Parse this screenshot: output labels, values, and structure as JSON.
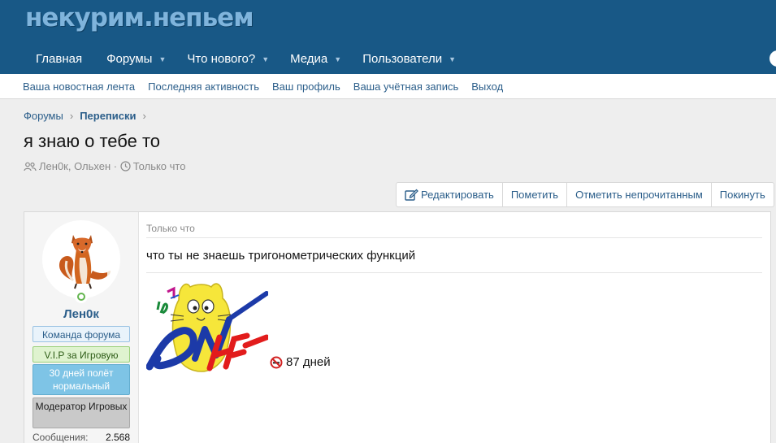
{
  "header": {
    "logo_text": "некурим.непьем",
    "nav": [
      {
        "label": "Главная",
        "has_caret": false
      },
      {
        "label": "Форумы",
        "has_caret": true
      },
      {
        "label": "Что нового?",
        "has_caret": true
      },
      {
        "label": "Медиа",
        "has_caret": true
      },
      {
        "label": "Пользователи",
        "has_caret": true
      }
    ]
  },
  "subnav": [
    "Ваша новостная лента",
    "Последняя активность",
    "Ваш профиль",
    "Ваша учётная запись",
    "Выход"
  ],
  "breadcrumb": [
    "Форумы",
    "Переписки"
  ],
  "page": {
    "title": "я знаю о тебе то",
    "participants": "Лен0к, Ольхен",
    "time": "Только что"
  },
  "actions": [
    "Редактировать",
    "Пометить",
    "Отметить непрочитанным",
    "Покинуть"
  ],
  "message": {
    "author": "Лен0к",
    "badges": [
      "Команда форума",
      "V.I.P за Игровую",
      "30 дней полёт нормальный",
      "Модератор Игровых"
    ],
    "stat_label": "Сообщения:",
    "stat_value": "2.568",
    "time": "Только что",
    "text": "что ты не знаешь тригонометрических функций",
    "signature_days": "87 дней"
  },
  "colors": {
    "header_bg": "#185886",
    "link": "#2b5e8a",
    "online": "#63b54f"
  }
}
